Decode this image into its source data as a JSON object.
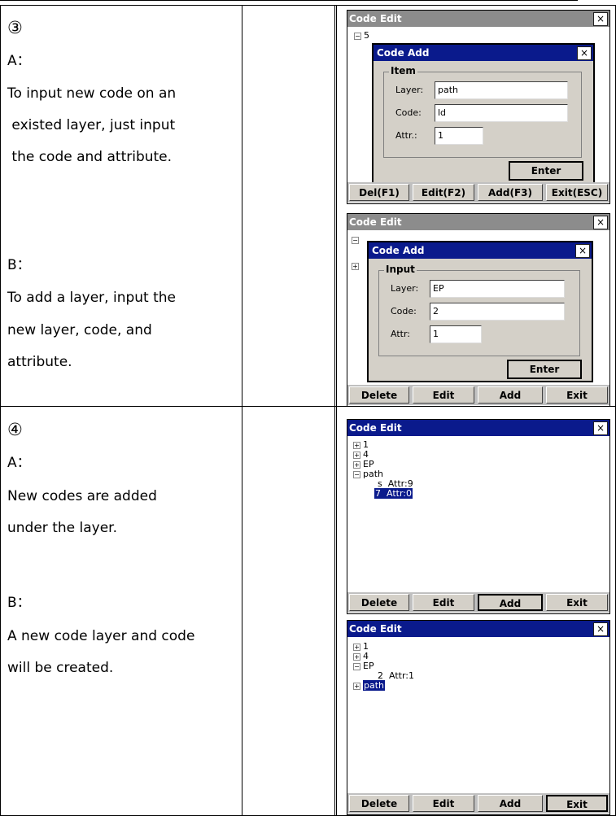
{
  "rows": [
    {
      "step": "③",
      "a_label": "A：",
      "a_lines": [
        "To input new code on an",
        " existed layer, just input",
        " the code and attribute."
      ],
      "b_label": "B：",
      "b_lines": [
        "To add a layer, input the",
        "new layer, code, and",
        "attribute."
      ]
    },
    {
      "step": "④",
      "a_label": "A：",
      "a_lines": [
        "New codes are added",
        "under the layer."
      ],
      "b_label": "B：",
      "b_lines": [
        "A new code layer and code",
        "will be created."
      ]
    }
  ],
  "screens": {
    "s1": {
      "title": "Code Edit",
      "close": "×",
      "tree_root": "5",
      "dialog_title": "Code Add",
      "dialog_close": "×",
      "group_label": "Item",
      "layer_label": "Layer:",
      "layer_value": "path",
      "code_label": "Code:",
      "code_value": "ld",
      "attr_label": "Attr.:",
      "attr_value": "1",
      "enter": "Enter",
      "buttons": [
        "Del(F1)",
        "Edit(F2)",
        "Add(F3)",
        "Exit(ESC)"
      ]
    },
    "s2": {
      "title": "Code Edit",
      "close": "×",
      "dialog_title": "Code Add",
      "dialog_close": "×",
      "group_label": "Input",
      "layer_label": "Layer:",
      "layer_value": "EP",
      "code_label": "Code:",
      "code_value": "2",
      "attr_label": "Attr:",
      "attr_value": "1",
      "enter": "Enter",
      "buttons": [
        "Delete",
        "Edit",
        "Add",
        "Exit"
      ]
    },
    "s3": {
      "title": "Code Edit",
      "close": "×",
      "tree": [
        "1",
        "4",
        "EP",
        "path",
        "s  Attr:9",
        "7  Attr:0"
      ],
      "buttons": [
        "Delete",
        "Edit",
        "Add",
        "Exit"
      ]
    },
    "s4": {
      "title": "Code Edit",
      "close": "×",
      "tree": [
        "1",
        "4",
        "EP",
        "2  Attr:1",
        "path"
      ],
      "buttons": [
        "Delete",
        "Edit",
        "Add",
        "Exit"
      ]
    }
  }
}
